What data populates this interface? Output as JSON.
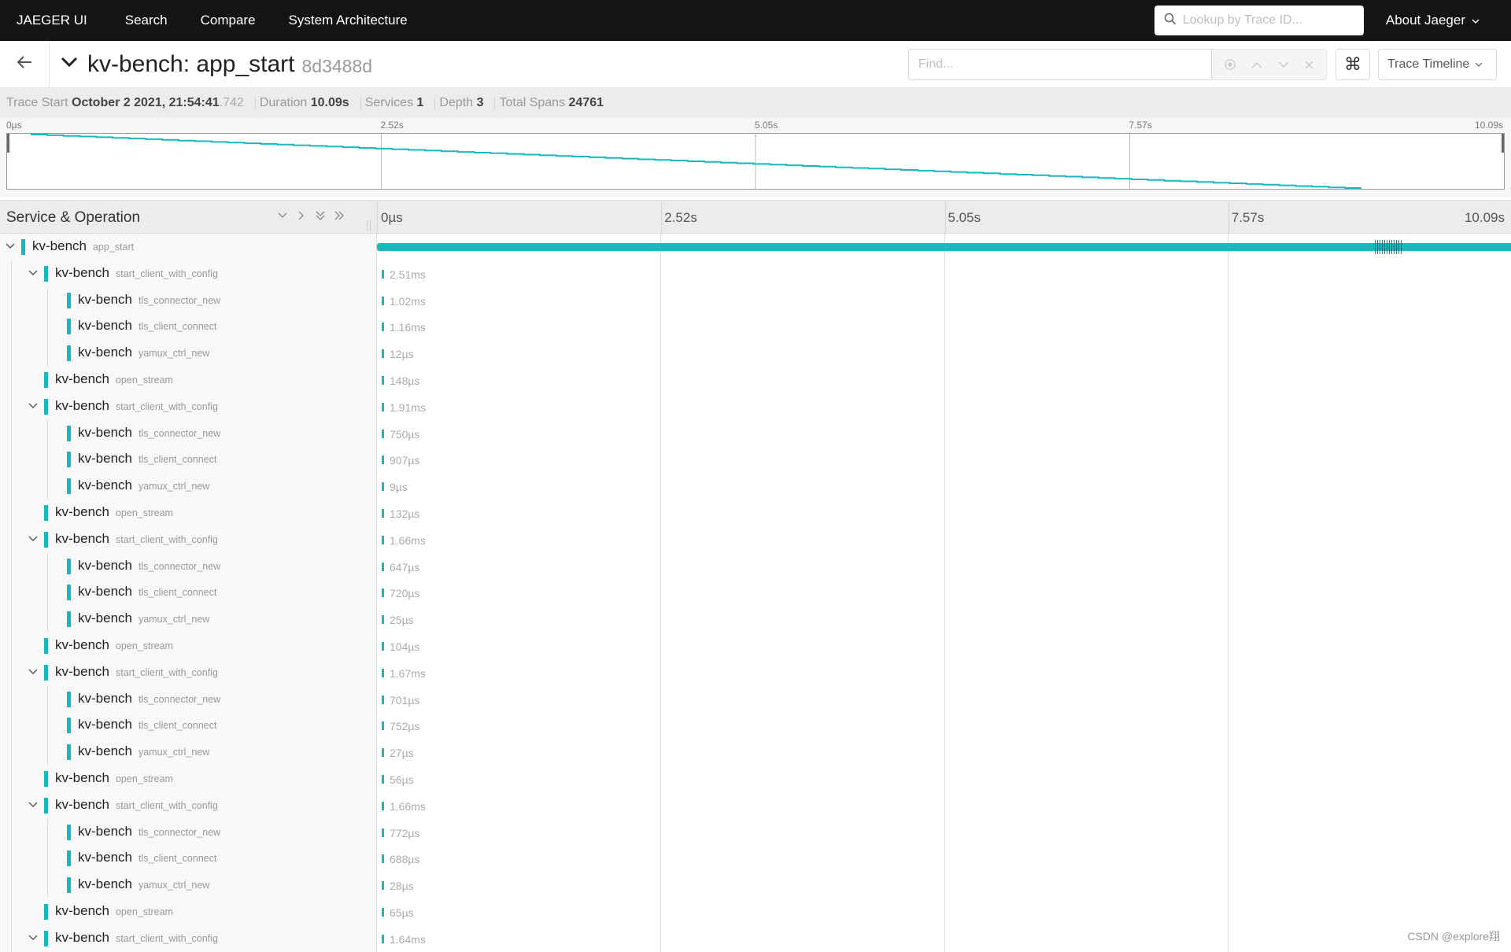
{
  "nav": {
    "brand": "JAEGER UI",
    "links": [
      "Search",
      "Compare",
      "System Architecture"
    ],
    "lookup_placeholder": "Lookup by Trace ID...",
    "about": "About Jaeger"
  },
  "trace_header": {
    "title": "kv-bench: app_start",
    "trace_id": "8d3488d",
    "find_placeholder": "Find...",
    "keyboard_shortcut_icon": "⌘",
    "view_mode": "Trace Timeline"
  },
  "summary": {
    "trace_start_label": "Trace Start",
    "trace_start_value": "October 2 2021, 21:54:41",
    "trace_start_ms": ".742",
    "duration_label": "Duration",
    "duration_value": "10.09s",
    "services_label": "Services",
    "services_value": "1",
    "depth_label": "Depth",
    "depth_value": "3",
    "total_spans_label": "Total Spans",
    "total_spans_value": "24761"
  },
  "timeline": {
    "ticks": [
      "0µs",
      "2.52s",
      "5.05s",
      "7.57s",
      "10.09s"
    ],
    "total_duration_s": 10.09
  },
  "table": {
    "header_left": "Service & Operation",
    "rows": [
      {
        "depth": 0,
        "expandable": true,
        "service": "kv-bench",
        "operation": "app_start",
        "duration": "",
        "root": true
      },
      {
        "depth": 1,
        "expandable": true,
        "service": "kv-bench",
        "operation": "start_client_with_config",
        "duration": "2.51ms"
      },
      {
        "depth": 2,
        "expandable": false,
        "service": "kv-bench",
        "operation": "tls_connector_new",
        "duration": "1.02ms"
      },
      {
        "depth": 2,
        "expandable": false,
        "service": "kv-bench",
        "operation": "tls_client_connect",
        "duration": "1.16ms"
      },
      {
        "depth": 2,
        "expandable": false,
        "service": "kv-bench",
        "operation": "yamux_ctrl_new",
        "duration": "12µs"
      },
      {
        "depth": 1,
        "expandable": false,
        "service": "kv-bench",
        "operation": "open_stream",
        "duration": "148µs"
      },
      {
        "depth": 1,
        "expandable": true,
        "service": "kv-bench",
        "operation": "start_client_with_config",
        "duration": "1.91ms"
      },
      {
        "depth": 2,
        "expandable": false,
        "service": "kv-bench",
        "operation": "tls_connector_new",
        "duration": "750µs"
      },
      {
        "depth": 2,
        "expandable": false,
        "service": "kv-bench",
        "operation": "tls_client_connect",
        "duration": "907µs"
      },
      {
        "depth": 2,
        "expandable": false,
        "service": "kv-bench",
        "operation": "yamux_ctrl_new",
        "duration": "9µs"
      },
      {
        "depth": 1,
        "expandable": false,
        "service": "kv-bench",
        "operation": "open_stream",
        "duration": "132µs"
      },
      {
        "depth": 1,
        "expandable": true,
        "service": "kv-bench",
        "operation": "start_client_with_config",
        "duration": "1.66ms"
      },
      {
        "depth": 2,
        "expandable": false,
        "service": "kv-bench",
        "operation": "tls_connector_new",
        "duration": "647µs"
      },
      {
        "depth": 2,
        "expandable": false,
        "service": "kv-bench",
        "operation": "tls_client_connect",
        "duration": "720µs"
      },
      {
        "depth": 2,
        "expandable": false,
        "service": "kv-bench",
        "operation": "yamux_ctrl_new",
        "duration": "25µs"
      },
      {
        "depth": 1,
        "expandable": false,
        "service": "kv-bench",
        "operation": "open_stream",
        "duration": "104µs"
      },
      {
        "depth": 1,
        "expandable": true,
        "service": "kv-bench",
        "operation": "start_client_with_config",
        "duration": "1.67ms"
      },
      {
        "depth": 2,
        "expandable": false,
        "service": "kv-bench",
        "operation": "tls_connector_new",
        "duration": "701µs"
      },
      {
        "depth": 2,
        "expandable": false,
        "service": "kv-bench",
        "operation": "tls_client_connect",
        "duration": "752µs"
      },
      {
        "depth": 2,
        "expandable": false,
        "service": "kv-bench",
        "operation": "yamux_ctrl_new",
        "duration": "27µs"
      },
      {
        "depth": 1,
        "expandable": false,
        "service": "kv-bench",
        "operation": "open_stream",
        "duration": "56µs"
      },
      {
        "depth": 1,
        "expandable": true,
        "service": "kv-bench",
        "operation": "start_client_with_config",
        "duration": "1.66ms"
      },
      {
        "depth": 2,
        "expandable": false,
        "service": "kv-bench",
        "operation": "tls_connector_new",
        "duration": "772µs"
      },
      {
        "depth": 2,
        "expandable": false,
        "service": "kv-bench",
        "operation": "tls_client_connect",
        "duration": "688µs"
      },
      {
        "depth": 2,
        "expandable": false,
        "service": "kv-bench",
        "operation": "yamux_ctrl_new",
        "duration": "28µs"
      },
      {
        "depth": 1,
        "expandable": false,
        "service": "kv-bench",
        "operation": "open_stream",
        "duration": "65µs"
      },
      {
        "depth": 1,
        "expandable": true,
        "service": "kv-bench",
        "operation": "start_client_with_config",
        "duration": "1.64ms"
      }
    ]
  },
  "colors": {
    "service": "#17b8be",
    "nav_bg": "#151515"
  },
  "watermark": "CSDN @explore翔"
}
